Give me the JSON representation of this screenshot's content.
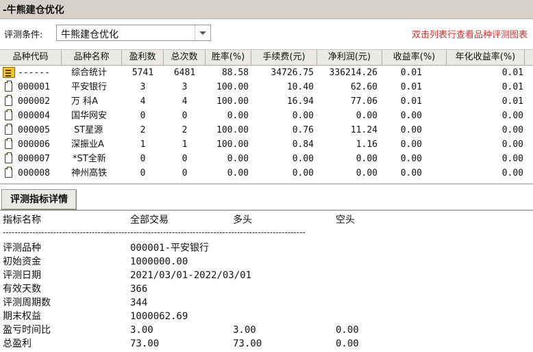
{
  "window": {
    "title": "-牛熊建仓优化"
  },
  "condition": {
    "label": "评测条件:",
    "selected": "牛熊建仓优化",
    "hint": "双击列表行查看品种评测图表"
  },
  "table": {
    "columns": [
      "品种代码",
      "品种名称",
      "盈利数",
      "总次数",
      "胜率(%)",
      "手续费(元)",
      "净利润(元)",
      "收益率(%)",
      "年化收益率(%)"
    ],
    "rows": [
      {
        "icon": "summary-icon",
        "code": "------",
        "name": "综合统计",
        "wins": "5741",
        "total": "6481",
        "winrate": "88.58",
        "fee": "34726.75",
        "profit": "336214.26",
        "return": "0.01",
        "annual": "0.01"
      },
      {
        "icon": "document-icon",
        "code": "000001",
        "name": "平安银行",
        "wins": "3",
        "total": "3",
        "winrate": "100.00",
        "fee": "10.40",
        "profit": "62.60",
        "return": "0.01",
        "annual": "0.01"
      },
      {
        "icon": "document-icon",
        "code": "000002",
        "name": "万 科A",
        "wins": "4",
        "total": "4",
        "winrate": "100.00",
        "fee": "16.94",
        "profit": "77.06",
        "return": "0.01",
        "annual": "0.01"
      },
      {
        "icon": "document-icon",
        "code": "000004",
        "name": "国华网安",
        "wins": "0",
        "total": "0",
        "winrate": "0.00",
        "fee": "0.00",
        "profit": "0.00",
        "return": "0.00",
        "annual": "0.00"
      },
      {
        "icon": "document-icon",
        "code": "000005",
        "name": "ST星源",
        "wins": "2",
        "total": "2",
        "winrate": "100.00",
        "fee": "0.76",
        "profit": "11.24",
        "return": "0.00",
        "annual": "0.00"
      },
      {
        "icon": "document-icon",
        "code": "000006",
        "name": "深振业A",
        "wins": "1",
        "total": "1",
        "winrate": "100.00",
        "fee": "0.84",
        "profit": "1.16",
        "return": "0.00",
        "annual": "0.00"
      },
      {
        "icon": "document-icon",
        "code": "000007",
        "name": "*ST全新",
        "wins": "0",
        "total": "0",
        "winrate": "0.00",
        "fee": "0.00",
        "profit": "0.00",
        "return": "0.00",
        "annual": "0.00"
      },
      {
        "icon": "document-icon",
        "code": "000008",
        "name": "神州高铁",
        "wins": "0",
        "total": "0",
        "winrate": "0.00",
        "fee": "0.00",
        "profit": "0.00",
        "return": "0.00",
        "annual": "0.00"
      }
    ]
  },
  "details": {
    "button_label": "评测指标详情",
    "header": [
      "指标名称",
      "全部交易",
      "多头",
      "空头"
    ],
    "divider": "------------------------------------------------------------------------------------------------------",
    "items": [
      {
        "label": "评测品种",
        "all": "000001-平安银行",
        "long": "",
        "short": ""
      },
      {
        "label": "初始资金",
        "all": "1000000.00",
        "long": "",
        "short": ""
      },
      {
        "label": "评测日期",
        "all": "2021/03/01-2022/03/01",
        "long": "",
        "short": ""
      },
      {
        "label": "有效天数",
        "all": "366",
        "long": "",
        "short": ""
      },
      {
        "label": "评测周期数",
        "all": "344",
        "long": "",
        "short": ""
      },
      {
        "label": "期末权益",
        "all": "1000062.69",
        "long": "",
        "short": ""
      },
      {
        "label": "盈亏时间比",
        "all": "3.00",
        "long": "3.00",
        "short": "0.00"
      },
      {
        "label": "总盈利",
        "all": "73.00",
        "long": "73.00",
        "short": "0.00"
      }
    ]
  }
}
